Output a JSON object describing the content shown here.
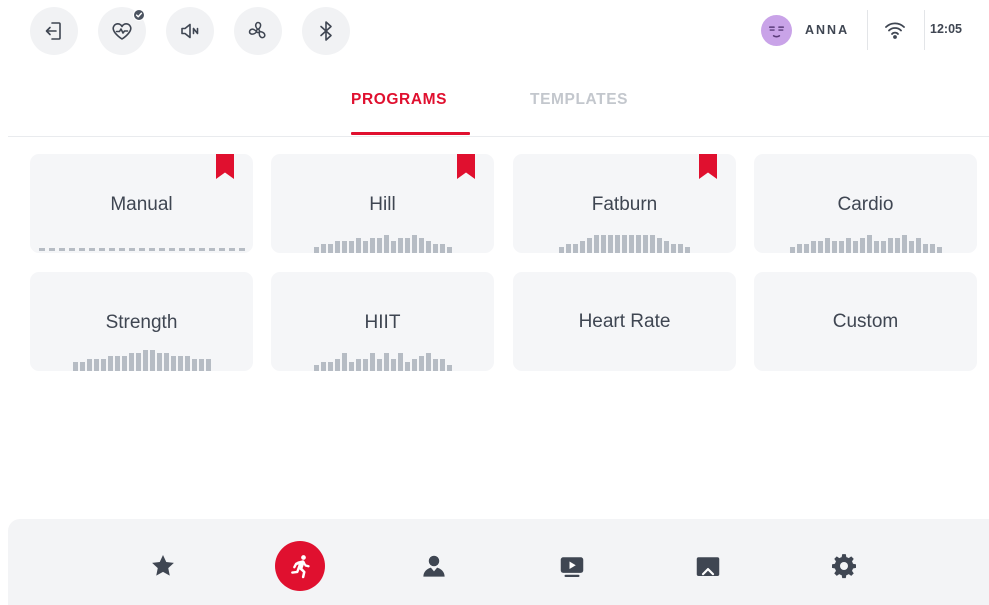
{
  "topbar": {
    "buttons": [
      {
        "icon": "exit-icon"
      },
      {
        "icon": "heart-rate-icon",
        "badge": "check"
      },
      {
        "icon": "speaker-muted-icon"
      },
      {
        "icon": "fan-icon"
      },
      {
        "icon": "bluetooth-icon"
      }
    ],
    "user_name": "ANNA",
    "time": "12:05"
  },
  "tabs": {
    "programs": "PROGRAMS",
    "templates": "TEMPLATES",
    "active": "programs"
  },
  "programs": [
    {
      "label": "Manual",
      "bookmarked": true,
      "profile": "flat"
    },
    {
      "label": "Hill",
      "bookmarked": true,
      "profile": [
        2,
        3,
        3,
        4,
        4,
        4,
        5,
        4,
        5,
        5,
        6,
        4,
        5,
        5,
        6,
        5,
        4,
        3,
        3,
        2
      ]
    },
    {
      "label": "Fatburn",
      "bookmarked": true,
      "profile": [
        2,
        3,
        3,
        4,
        5,
        6,
        6,
        6,
        6,
        6,
        6,
        6,
        6,
        6,
        5,
        4,
        3,
        3,
        2
      ]
    },
    {
      "label": "Cardio",
      "bookmarked": false,
      "profile": [
        2,
        3,
        3,
        4,
        4,
        5,
        4,
        4,
        5,
        4,
        5,
        6,
        4,
        4,
        5,
        5,
        6,
        4,
        5,
        3,
        3,
        2
      ]
    },
    {
      "label": "Strength",
      "bookmarked": false,
      "profile": [
        3,
        3,
        4,
        4,
        4,
        5,
        5,
        5,
        6,
        6,
        7,
        7,
        6,
        6,
        5,
        5,
        5,
        4,
        4,
        4
      ]
    },
    {
      "label": "HIIT",
      "bookmarked": false,
      "profile": [
        2,
        3,
        3,
        4,
        6,
        3,
        4,
        4,
        6,
        4,
        6,
        4,
        6,
        3,
        4,
        5,
        6,
        4,
        4,
        2
      ]
    },
    {
      "label": "Heart Rate",
      "bookmarked": false,
      "profile": null
    },
    {
      "label": "Custom",
      "bookmarked": false,
      "profile": null
    }
  ],
  "nav": [
    {
      "icon": "star-icon",
      "active": false
    },
    {
      "icon": "running-icon",
      "active": true
    },
    {
      "icon": "user-icon",
      "active": false
    },
    {
      "icon": "video-icon",
      "active": false
    },
    {
      "icon": "image-icon",
      "active": false
    },
    {
      "icon": "gear-icon",
      "active": false
    }
  ],
  "colors": {
    "accent": "#e0102f",
    "text": "#3f4652",
    "card": "#f5f6f8",
    "bar": "#b6bcc4"
  }
}
